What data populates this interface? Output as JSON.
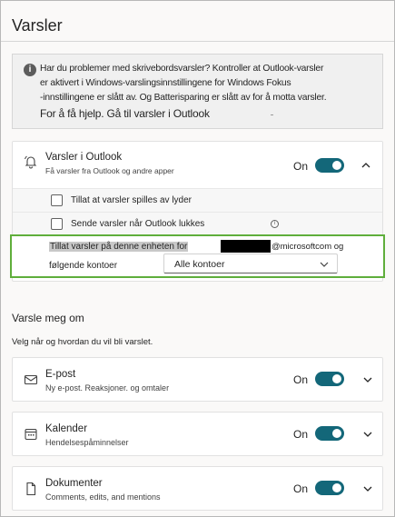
{
  "page": {
    "title": "Varsler"
  },
  "info_banner": {
    "line1": "Har du problemer med skrivebordsvarsler? Kontroller at Outlook-varsler",
    "line2": "er aktivert i Windows-varslingsinnstillingene for Windows Fokus",
    "line3": "-innstillingene er slått av. Og Batterisparing er slått av for å motta varsler.",
    "line4": "For å få hjelp. Gå til varsler i Outlook"
  },
  "outlook_card": {
    "title": "Varsler i Outlook",
    "subtitle": "Få varsler fra Outlook og andre apper",
    "state_label": "On",
    "sound_option": "Tillat at varsler spilles av lyder",
    "close_option": "Sende varsler når Outlook lukkes",
    "allow_prefix": "Tillat varsler på denne enheten for",
    "allow_domain": "@microsoftcom og",
    "allow_line2": "følgende kontoer",
    "accounts_dropdown": "Alle kontoer"
  },
  "notify_section": {
    "title": "Varsle meg om",
    "description": "Velg når og hvordan du vil bli varslet."
  },
  "categories": [
    {
      "title": "E-post",
      "subtitle": "Ny e-post. Reaksjoner. og omtaler",
      "state_label": "On",
      "icon": "mail-icon"
    },
    {
      "title": "Kalender",
      "subtitle": "Hendelsespåminnelser",
      "state_label": "On",
      "icon": "calendar-icon"
    },
    {
      "title": "Dokumenter",
      "subtitle": "Comments, edits, and mentions",
      "state_label": "On",
      "icon": "document-icon"
    }
  ],
  "colors": {
    "toggle_on": "#136779",
    "highlight_border": "#5fae3b"
  }
}
